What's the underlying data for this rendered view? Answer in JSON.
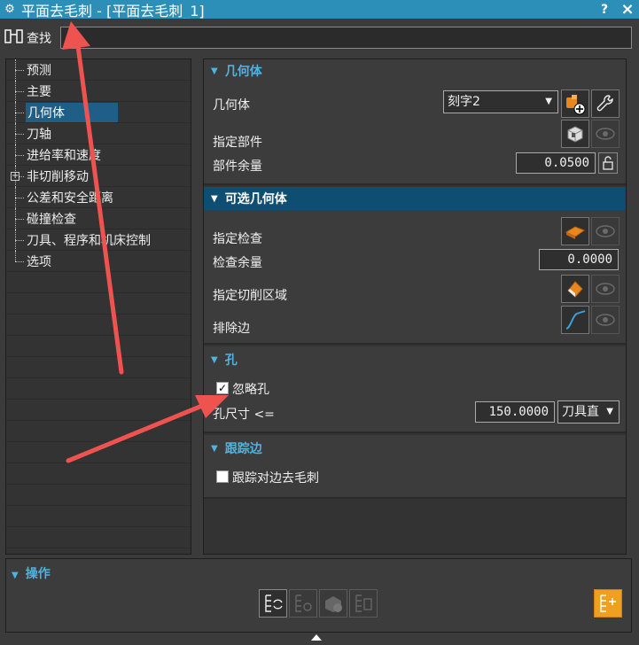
{
  "window": {
    "title": "平面去毛刺 - [平面去毛刺_1]",
    "help_label": "?",
    "close_label": "×"
  },
  "find": {
    "label": "查找",
    "value": ""
  },
  "tree": {
    "items": [
      {
        "label": "预测"
      },
      {
        "label": "主要"
      },
      {
        "label": "几何体",
        "selected": true
      },
      {
        "label": "刀轴"
      },
      {
        "label": "进给率和速度"
      },
      {
        "label": "非切削移动",
        "expandable": true
      },
      {
        "label": "公差和安全距离"
      },
      {
        "label": "碰撞检查"
      },
      {
        "label": "刀具、程序和机床控制"
      },
      {
        "label": "选项"
      }
    ]
  },
  "geometry": {
    "header": "几何体",
    "geometry_label": "几何体",
    "geometry_value": "刻字2",
    "specify_part_label": "指定部件",
    "part_stock_label": "部件余量",
    "part_stock_value": "0.0500"
  },
  "optional_geometry": {
    "header": "可选几何体",
    "specify_check_label": "指定检查",
    "check_stock_label": "检查余量",
    "check_stock_value": "0.0000",
    "specify_cut_area_label": "指定切削区域",
    "exclude_edges_label": "排除边"
  },
  "holes": {
    "header": "孔",
    "ignore_holes_label": "忽略孔",
    "ignore_holes_checked": true,
    "hole_size_label": "孔尺寸 <=",
    "hole_size_value": "150.0000",
    "hole_size_unit": "刀具直"
  },
  "trace_edges": {
    "header": "跟踪边",
    "trace_opposite_label": "跟踪对边去毛刺",
    "trace_opposite_checked": false
  },
  "operations": {
    "header": "操作"
  },
  "colors": {
    "title_bar": "#2c8fb8",
    "section_header_text": "#4fb3e0",
    "selected_header_bg": "#0f4e73",
    "annotation_arrow": "#ef5350"
  }
}
